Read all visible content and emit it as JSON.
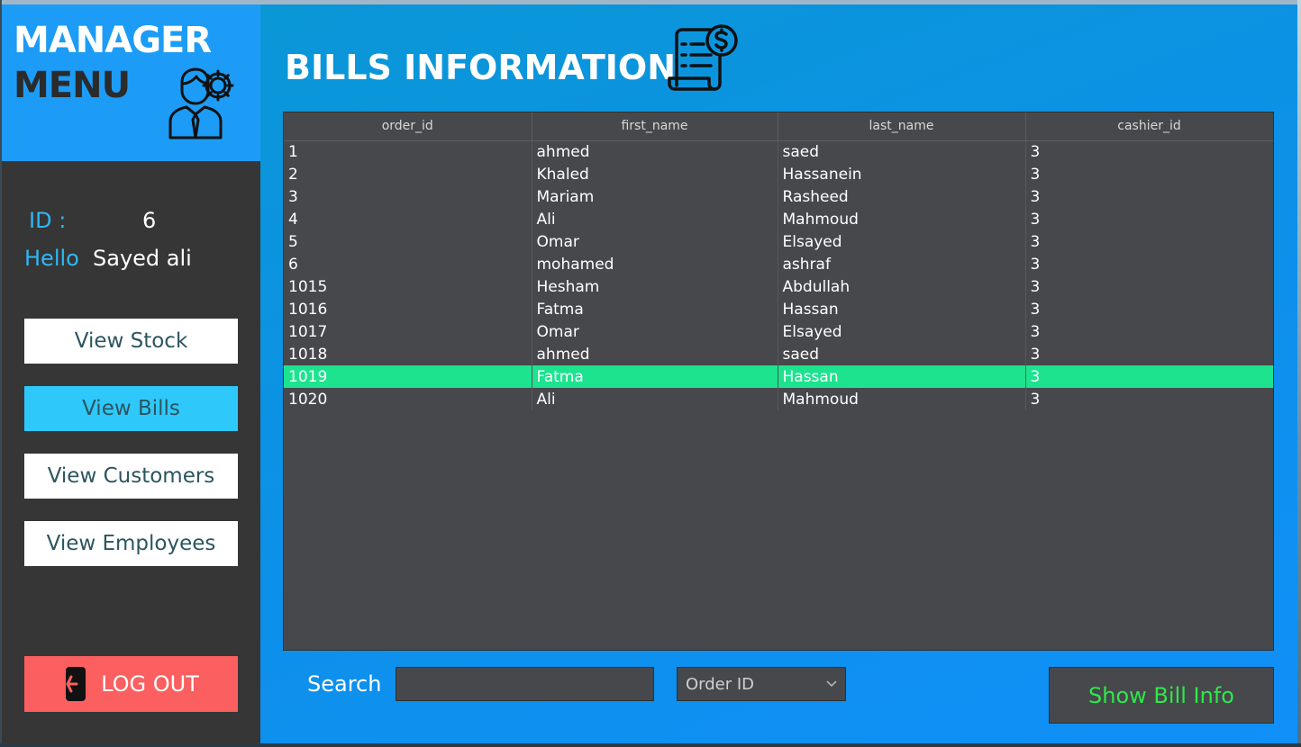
{
  "brand": {
    "line1": "MANAGER",
    "line2": "MENU",
    "icon": "manager-gear-icon"
  },
  "user": {
    "id_label": "ID :",
    "id_value": "6",
    "hello_label": "Hello",
    "name": "Sayed ali"
  },
  "nav": {
    "stock": "View Stock",
    "bills": "View Bills",
    "customers": "View Customers",
    "employees": "View Employees",
    "active": "bills"
  },
  "logout": {
    "label": "LOG OUT",
    "icon": "phone-exit-icon"
  },
  "page": {
    "title": "BILLS INFORMATION",
    "icon": "bill-dollar-icon"
  },
  "table": {
    "headers": [
      "order_id",
      "first_name",
      "last_name",
      "cashier_id"
    ],
    "rows": [
      [
        "1",
        "ahmed",
        "saed",
        "3"
      ],
      [
        "2",
        "Khaled",
        "Hassanein",
        "3"
      ],
      [
        "3",
        "Mariam",
        "Rasheed",
        "3"
      ],
      [
        "4",
        "Ali",
        "Mahmoud",
        "3"
      ],
      [
        "5",
        "Omar",
        "Elsayed",
        "3"
      ],
      [
        "6",
        "mohamed",
        "ashraf",
        "3"
      ],
      [
        "1015",
        "Hesham",
        "Abdullah",
        "3"
      ],
      [
        "1016",
        "Fatma",
        "Hassan",
        "3"
      ],
      [
        "1017",
        "Omar",
        "Elsayed",
        "3"
      ],
      [
        "1018",
        "ahmed",
        "saed",
        "3"
      ],
      [
        "1019",
        "Fatma",
        "Hassan",
        "3"
      ],
      [
        "1020",
        "Ali",
        "Mahmoud",
        "3"
      ]
    ],
    "selected_row": 10
  },
  "search": {
    "label": "Search",
    "value": "",
    "filter_selected": "Order ID"
  },
  "actions": {
    "show_bill": "Show Bill Info"
  },
  "colors": {
    "sidebar": "#363636",
    "brand_bg": "#1c9cf6",
    "main_bg": "#0d90ea",
    "table_bg": "#46484b",
    "selected_row": "#1de38f",
    "active_nav": "#2fc8fa",
    "logout_bg": "#fb5f5f",
    "show_btn_text": "#2fe84a",
    "accent_text": "#2fb8f4"
  }
}
